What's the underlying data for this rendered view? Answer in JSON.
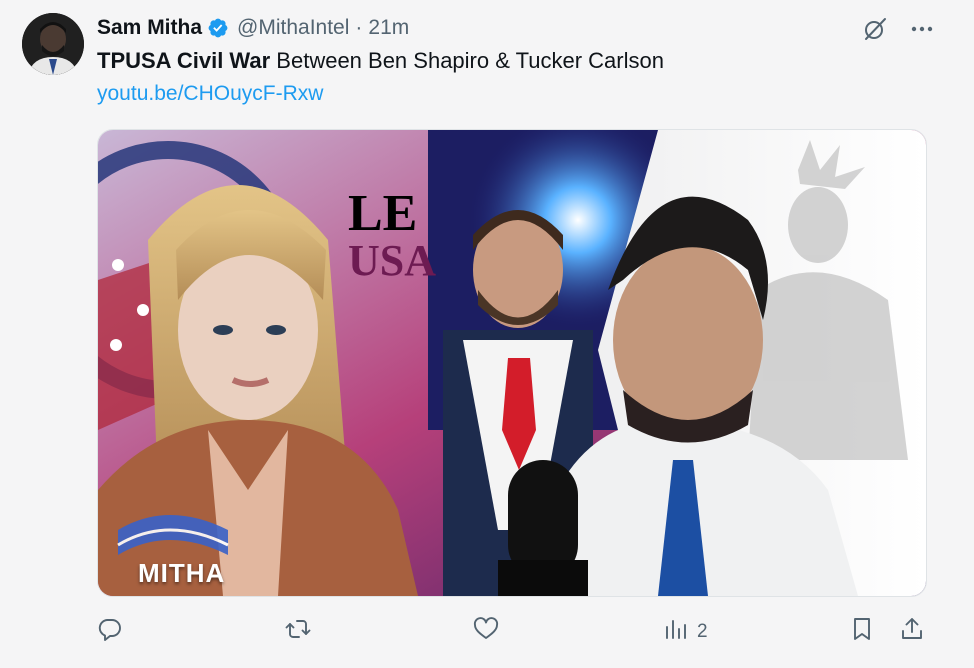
{
  "tweet": {
    "author_name": "Sam Mitha",
    "handle": "@MithaIntel",
    "separator": "·",
    "time": "21m",
    "text_bold": "TPUSA Civil War",
    "text_rest": " Between Ben Shapiro & Tucker Carlson",
    "link": "youtu.be/CHOuycF-Rxw"
  },
  "media": {
    "overlay_logo": "MITHA",
    "bg_text_1": "LE",
    "bg_text_2": "USA"
  },
  "actions": {
    "views_count": "2"
  },
  "icons": {
    "verified": "verified-badge-icon",
    "grok": "grok-icon",
    "more": "more-icon",
    "reply": "reply-icon",
    "retweet": "retweet-icon",
    "like": "like-icon",
    "views": "views-icon",
    "bookmark": "bookmark-icon",
    "share": "share-icon"
  },
  "colors": {
    "accent": "#1d9bf0",
    "muted": "#536471",
    "text": "#0f1419"
  }
}
